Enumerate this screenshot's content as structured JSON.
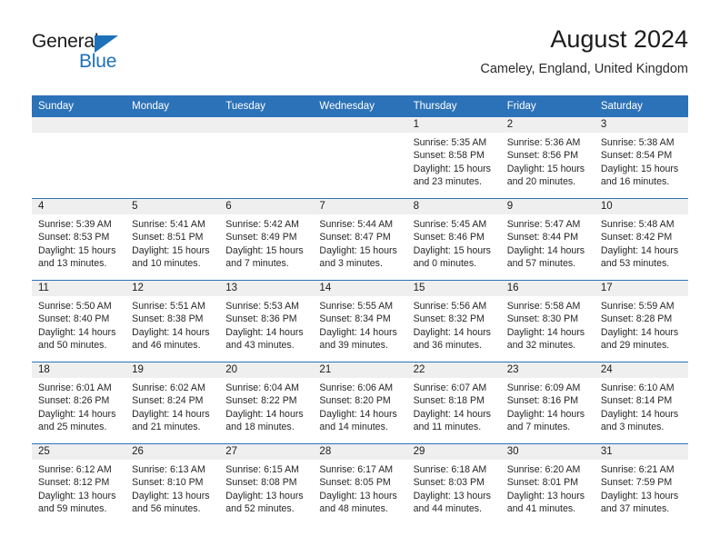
{
  "brand": {
    "name_part1": "General",
    "name_part2": "Blue",
    "accent_color": "#1d71b8"
  },
  "header": {
    "title": "August 2024",
    "subtitle": "Cameley, England, United Kingdom"
  },
  "theme": {
    "header_bar_color": "#2c72b8",
    "daynum_band_color": "#efefef",
    "row_rule_color": "#2c72b8"
  },
  "weekday_headers": [
    "Sunday",
    "Monday",
    "Tuesday",
    "Wednesday",
    "Thursday",
    "Friday",
    "Saturday"
  ],
  "weeks": [
    [
      {
        "day": "",
        "empty": true,
        "sunrise": "",
        "sunset": "",
        "daylight_line1": "",
        "daylight_line2": ""
      },
      {
        "day": "",
        "empty": true,
        "sunrise": "",
        "sunset": "",
        "daylight_line1": "",
        "daylight_line2": ""
      },
      {
        "day": "",
        "empty": true,
        "sunrise": "",
        "sunset": "",
        "daylight_line1": "",
        "daylight_line2": ""
      },
      {
        "day": "",
        "empty": true,
        "sunrise": "",
        "sunset": "",
        "daylight_line1": "",
        "daylight_line2": ""
      },
      {
        "day": "1",
        "sunrise": "Sunrise: 5:35 AM",
        "sunset": "Sunset: 8:58 PM",
        "daylight_line1": "Daylight: 15 hours",
        "daylight_line2": "and 23 minutes."
      },
      {
        "day": "2",
        "sunrise": "Sunrise: 5:36 AM",
        "sunset": "Sunset: 8:56 PM",
        "daylight_line1": "Daylight: 15 hours",
        "daylight_line2": "and 20 minutes."
      },
      {
        "day": "3",
        "sunrise": "Sunrise: 5:38 AM",
        "sunset": "Sunset: 8:54 PM",
        "daylight_line1": "Daylight: 15 hours",
        "daylight_line2": "and 16 minutes."
      }
    ],
    [
      {
        "day": "4",
        "sunrise": "Sunrise: 5:39 AM",
        "sunset": "Sunset: 8:53 PM",
        "daylight_line1": "Daylight: 15 hours",
        "daylight_line2": "and 13 minutes."
      },
      {
        "day": "5",
        "sunrise": "Sunrise: 5:41 AM",
        "sunset": "Sunset: 8:51 PM",
        "daylight_line1": "Daylight: 15 hours",
        "daylight_line2": "and 10 minutes."
      },
      {
        "day": "6",
        "sunrise": "Sunrise: 5:42 AM",
        "sunset": "Sunset: 8:49 PM",
        "daylight_line1": "Daylight: 15 hours",
        "daylight_line2": "and 7 minutes."
      },
      {
        "day": "7",
        "sunrise": "Sunrise: 5:44 AM",
        "sunset": "Sunset: 8:47 PM",
        "daylight_line1": "Daylight: 15 hours",
        "daylight_line2": "and 3 minutes."
      },
      {
        "day": "8",
        "sunrise": "Sunrise: 5:45 AM",
        "sunset": "Sunset: 8:46 PM",
        "daylight_line1": "Daylight: 15 hours",
        "daylight_line2": "and 0 minutes."
      },
      {
        "day": "9",
        "sunrise": "Sunrise: 5:47 AM",
        "sunset": "Sunset: 8:44 PM",
        "daylight_line1": "Daylight: 14 hours",
        "daylight_line2": "and 57 minutes."
      },
      {
        "day": "10",
        "sunrise": "Sunrise: 5:48 AM",
        "sunset": "Sunset: 8:42 PM",
        "daylight_line1": "Daylight: 14 hours",
        "daylight_line2": "and 53 minutes."
      }
    ],
    [
      {
        "day": "11",
        "sunrise": "Sunrise: 5:50 AM",
        "sunset": "Sunset: 8:40 PM",
        "daylight_line1": "Daylight: 14 hours",
        "daylight_line2": "and 50 minutes."
      },
      {
        "day": "12",
        "sunrise": "Sunrise: 5:51 AM",
        "sunset": "Sunset: 8:38 PM",
        "daylight_line1": "Daylight: 14 hours",
        "daylight_line2": "and 46 minutes."
      },
      {
        "day": "13",
        "sunrise": "Sunrise: 5:53 AM",
        "sunset": "Sunset: 8:36 PM",
        "daylight_line1": "Daylight: 14 hours",
        "daylight_line2": "and 43 minutes."
      },
      {
        "day": "14",
        "sunrise": "Sunrise: 5:55 AM",
        "sunset": "Sunset: 8:34 PM",
        "daylight_line1": "Daylight: 14 hours",
        "daylight_line2": "and 39 minutes."
      },
      {
        "day": "15",
        "sunrise": "Sunrise: 5:56 AM",
        "sunset": "Sunset: 8:32 PM",
        "daylight_line1": "Daylight: 14 hours",
        "daylight_line2": "and 36 minutes."
      },
      {
        "day": "16",
        "sunrise": "Sunrise: 5:58 AM",
        "sunset": "Sunset: 8:30 PM",
        "daylight_line1": "Daylight: 14 hours",
        "daylight_line2": "and 32 minutes."
      },
      {
        "day": "17",
        "sunrise": "Sunrise: 5:59 AM",
        "sunset": "Sunset: 8:28 PM",
        "daylight_line1": "Daylight: 14 hours",
        "daylight_line2": "and 29 minutes."
      }
    ],
    [
      {
        "day": "18",
        "sunrise": "Sunrise: 6:01 AM",
        "sunset": "Sunset: 8:26 PM",
        "daylight_line1": "Daylight: 14 hours",
        "daylight_line2": "and 25 minutes."
      },
      {
        "day": "19",
        "sunrise": "Sunrise: 6:02 AM",
        "sunset": "Sunset: 8:24 PM",
        "daylight_line1": "Daylight: 14 hours",
        "daylight_line2": "and 21 minutes."
      },
      {
        "day": "20",
        "sunrise": "Sunrise: 6:04 AM",
        "sunset": "Sunset: 8:22 PM",
        "daylight_line1": "Daylight: 14 hours",
        "daylight_line2": "and 18 minutes."
      },
      {
        "day": "21",
        "sunrise": "Sunrise: 6:06 AM",
        "sunset": "Sunset: 8:20 PM",
        "daylight_line1": "Daylight: 14 hours",
        "daylight_line2": "and 14 minutes."
      },
      {
        "day": "22",
        "sunrise": "Sunrise: 6:07 AM",
        "sunset": "Sunset: 8:18 PM",
        "daylight_line1": "Daylight: 14 hours",
        "daylight_line2": "and 11 minutes."
      },
      {
        "day": "23",
        "sunrise": "Sunrise: 6:09 AM",
        "sunset": "Sunset: 8:16 PM",
        "daylight_line1": "Daylight: 14 hours",
        "daylight_line2": "and 7 minutes."
      },
      {
        "day": "24",
        "sunrise": "Sunrise: 6:10 AM",
        "sunset": "Sunset: 8:14 PM",
        "daylight_line1": "Daylight: 14 hours",
        "daylight_line2": "and 3 minutes."
      }
    ],
    [
      {
        "day": "25",
        "sunrise": "Sunrise: 6:12 AM",
        "sunset": "Sunset: 8:12 PM",
        "daylight_line1": "Daylight: 13 hours",
        "daylight_line2": "and 59 minutes."
      },
      {
        "day": "26",
        "sunrise": "Sunrise: 6:13 AM",
        "sunset": "Sunset: 8:10 PM",
        "daylight_line1": "Daylight: 13 hours",
        "daylight_line2": "and 56 minutes."
      },
      {
        "day": "27",
        "sunrise": "Sunrise: 6:15 AM",
        "sunset": "Sunset: 8:08 PM",
        "daylight_line1": "Daylight: 13 hours",
        "daylight_line2": "and 52 minutes."
      },
      {
        "day": "28",
        "sunrise": "Sunrise: 6:17 AM",
        "sunset": "Sunset: 8:05 PM",
        "daylight_line1": "Daylight: 13 hours",
        "daylight_line2": "and 48 minutes."
      },
      {
        "day": "29",
        "sunrise": "Sunrise: 6:18 AM",
        "sunset": "Sunset: 8:03 PM",
        "daylight_line1": "Daylight: 13 hours",
        "daylight_line2": "and 44 minutes."
      },
      {
        "day": "30",
        "sunrise": "Sunrise: 6:20 AM",
        "sunset": "Sunset: 8:01 PM",
        "daylight_line1": "Daylight: 13 hours",
        "daylight_line2": "and 41 minutes."
      },
      {
        "day": "31",
        "sunrise": "Sunrise: 6:21 AM",
        "sunset": "Sunset: 7:59 PM",
        "daylight_line1": "Daylight: 13 hours",
        "daylight_line2": "and 37 minutes."
      }
    ]
  ]
}
